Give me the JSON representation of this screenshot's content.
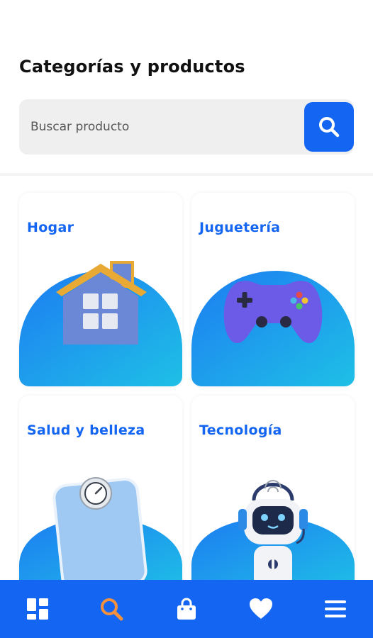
{
  "page": {
    "title": "Categorías y productos"
  },
  "search": {
    "placeholder": "Buscar producto",
    "value": "",
    "button_icon": "search-icon"
  },
  "categories": [
    {
      "label": "Hogar",
      "icon": "house-icon"
    },
    {
      "label": "Juguetería",
      "icon": "gamepad-icon"
    },
    {
      "label": "Salud y belleza",
      "icon": "scale-icon"
    },
    {
      "label": "Tecnología",
      "icon": "robot-icon"
    }
  ],
  "bottom_nav": {
    "items": [
      {
        "icon": "dashboard-icon",
        "active": false
      },
      {
        "icon": "search-icon",
        "active": true
      },
      {
        "icon": "shopping-bag-icon",
        "active": false
      },
      {
        "icon": "heart-icon",
        "active": false
      },
      {
        "icon": "menu-icon",
        "active": false
      }
    ],
    "active_color": "#f5903d"
  },
  "colors": {
    "brand": "#1466f2",
    "card_blob_start": "#1d7cf2",
    "card_blob_end": "#1ec0e6"
  }
}
